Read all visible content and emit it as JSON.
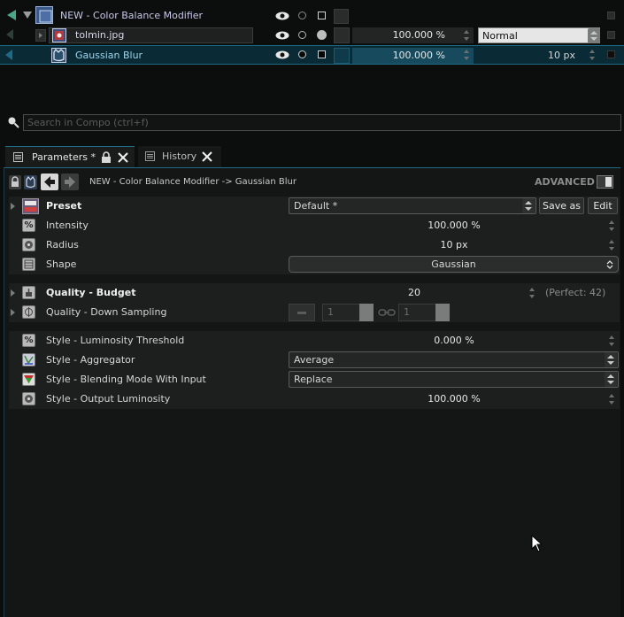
{
  "compo": {
    "rows": [
      {
        "name": "NEW - Color Balance Modifier"
      },
      {
        "name": "tolmin.jpg",
        "opacity": "100.000 %",
        "blend_mode": "Normal"
      },
      {
        "name": "Gaussian Blur",
        "opacity": "100.000 %",
        "radius": "10 px"
      }
    ]
  },
  "search": {
    "placeholder": "Search in Compo (ctrl+f)"
  },
  "tabs": [
    {
      "label": "Parameters *"
    },
    {
      "label": "History"
    }
  ],
  "breadcrumb": "NEW - Color Balance Modifier -> Gaussian Blur",
  "advanced_label": "ADVANCED",
  "params": {
    "preset": {
      "label": "Preset",
      "value": "Default *",
      "save_as": "Save as",
      "edit": "Edit"
    },
    "intensity": {
      "label": "Intensity",
      "value": "100.000 %"
    },
    "radius": {
      "label": "Radius",
      "value": "10 px"
    },
    "shape": {
      "label": "Shape",
      "value": "Gaussian"
    },
    "quality_budget": {
      "label": "Quality - Budget",
      "value": "20",
      "hint": "(Perfect: 42)"
    },
    "quality_down": {
      "label": "Quality - Down Sampling",
      "x": "1",
      "y": "1"
    },
    "lum_threshold": {
      "label": "Style - Luminosity Threshold",
      "value": "0.000 %"
    },
    "aggregator": {
      "label": "Style - Aggregator",
      "value": "Average"
    },
    "blending": {
      "label": "Style - Blending Mode With Input",
      "value": "Replace"
    },
    "output_lum": {
      "label": "Style - Output Luminosity",
      "value": "100.000 %"
    }
  },
  "colors": {
    "accent": "#1f6b85",
    "selected_row": "#0a2a36",
    "selected_text": "#9fd6ea"
  }
}
